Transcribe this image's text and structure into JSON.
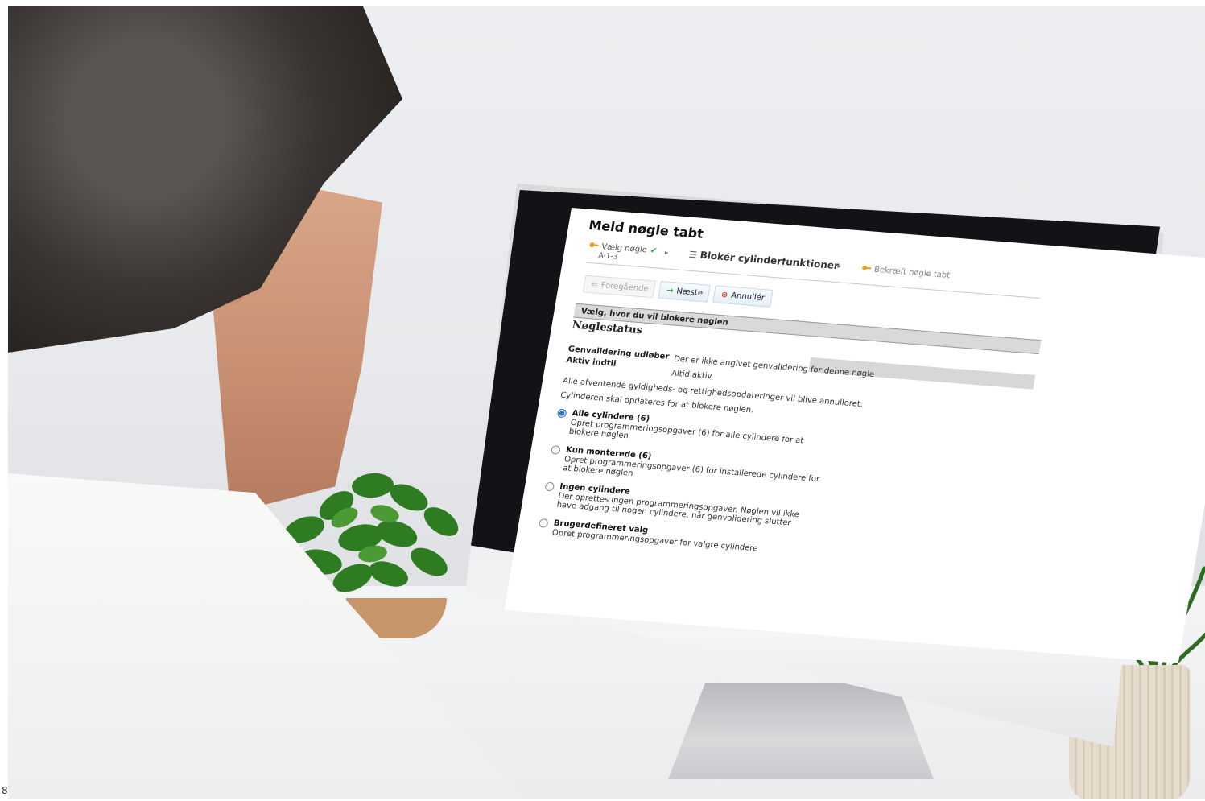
{
  "page": {
    "title": "Meld nøgle tabt"
  },
  "steps": [
    {
      "label": "Vælg nøgle",
      "sub": "A-1-3",
      "icon": "key-icon",
      "status": "done"
    },
    {
      "label": "Blokér cylinderfunktioner",
      "icon": "list-icon",
      "status": "current"
    },
    {
      "label": "Bekræft nøgle tabt",
      "icon": "key-icon",
      "status": "pending"
    }
  ],
  "buttons": {
    "previous": "Foregående",
    "next": "Næste",
    "cancel": "Annullér"
  },
  "section": {
    "header": "Vælg, hvor du vil blokere nøglen",
    "title": "Nøglestatus",
    "fields": [
      {
        "label": "Genvalidering udløber",
        "value": "Der er ikke angivet genvalidering for denne nøgle"
      },
      {
        "label": "Aktiv indtil",
        "value": "Altid aktiv"
      }
    ],
    "notes": [
      "Alle afventende gyldigheds- og rettighedsopdateringer vil blive annulleret.",
      "Cylinderen skal opdateres for at blokere nøglen."
    ]
  },
  "options": [
    {
      "title": "Alle cylindere (6)",
      "desc": "Opret programmeringsopgaver (6) for alle cylindere for at blokere nøglen",
      "checked": true
    },
    {
      "title": "Kun monterede (6)",
      "desc": "Opret programmeringsopgaver (6) for installerede cylindere for at blokere nøglen",
      "checked": false
    },
    {
      "title": "Ingen cylindere",
      "desc": "Der oprettes ingen programmeringsopgaver. Nøglen vil ikke have adgang til nogen cylindere, når genvalidering slutter",
      "checked": false
    },
    {
      "title": "Brugerdefineret valg",
      "desc": "Opret programmeringsopgaver for valgte cylindere",
      "checked": false
    }
  ],
  "footer_char": "8",
  "colors": {
    "accent": "#2b78c4",
    "success": "#2e9d35",
    "cancel": "#d9433b",
    "bar": "#d9d9d9"
  }
}
